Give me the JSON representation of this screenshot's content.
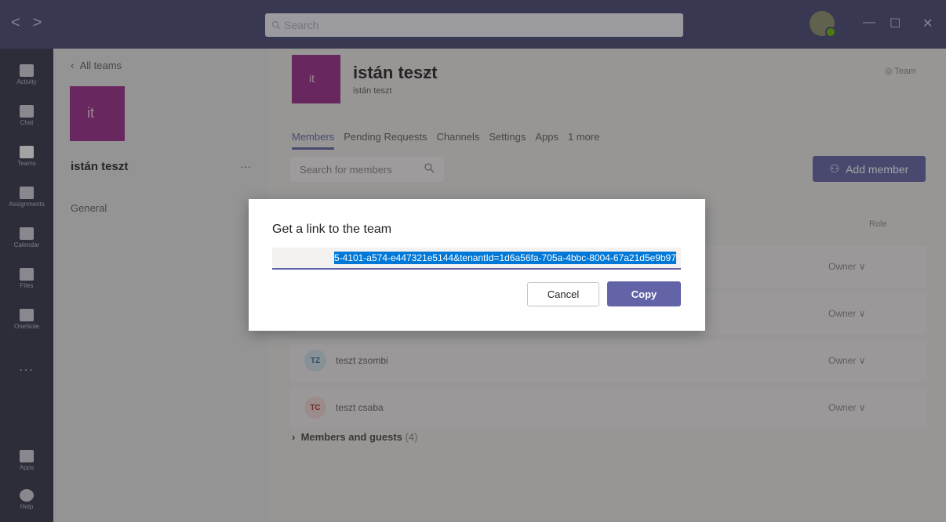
{
  "titlebar": {
    "nav_back": "<",
    "nav_forward": ">",
    "search_placeholder": "Search",
    "minimize": "—",
    "maximize": "☐",
    "close": "✕"
  },
  "rail": {
    "items": [
      {
        "label": "Activity",
        "icon": "bell-icon"
      },
      {
        "label": "Chat",
        "icon": "chat-icon"
      },
      {
        "label": "Teams",
        "icon": "teams-icon"
      },
      {
        "label": "Assignments",
        "icon": "assignments-icon"
      },
      {
        "label": "Calendar",
        "icon": "calendar-icon"
      },
      {
        "label": "Files",
        "icon": "files-icon"
      },
      {
        "label": "OneNote",
        "icon": "onenote-icon"
      }
    ],
    "more": "...",
    "bottom": [
      {
        "label": "Apps",
        "icon": "apps-icon"
      },
      {
        "label": "Help",
        "icon": "help-icon"
      }
    ]
  },
  "leftpane": {
    "all_teams": "All teams",
    "team_initials": "it",
    "team_name": "istán teszt",
    "more": "···",
    "channel": "General"
  },
  "main": {
    "team_initials": "it",
    "team_title": "istán teszt",
    "title_more": "···",
    "team_sub": "istán teszt",
    "badge": "Team",
    "tabs": [
      "Members",
      "Pending Requests",
      "Channels",
      "Settings",
      "Apps",
      "1 more"
    ],
    "search_placeholder": "Search for members",
    "add_member": "Add member",
    "role_header": "Role",
    "rows": [
      {
        "initials": "",
        "name": "",
        "role": "Owner"
      },
      {
        "initials": "",
        "name": "",
        "role": "Owner"
      },
      {
        "initials": "TZ",
        "name": "teszt zsombi",
        "role": "Owner"
      },
      {
        "initials": "TC",
        "name": "teszt csaba",
        "role": "Owner"
      }
    ],
    "members_guests": "Members and guests",
    "members_guests_count": "(4)"
  },
  "dialog": {
    "title": "Get a link to the team",
    "link": "5-4101-a574-e447321e5144&tenantId=1d6a56fa-705a-4bbc-8004-67a21d5e9b97",
    "cancel": "Cancel",
    "copy": "Copy"
  },
  "colors": {
    "brand": "#6264a7",
    "team_tile": "#9a2a8c",
    "selection": "#0078d7"
  }
}
